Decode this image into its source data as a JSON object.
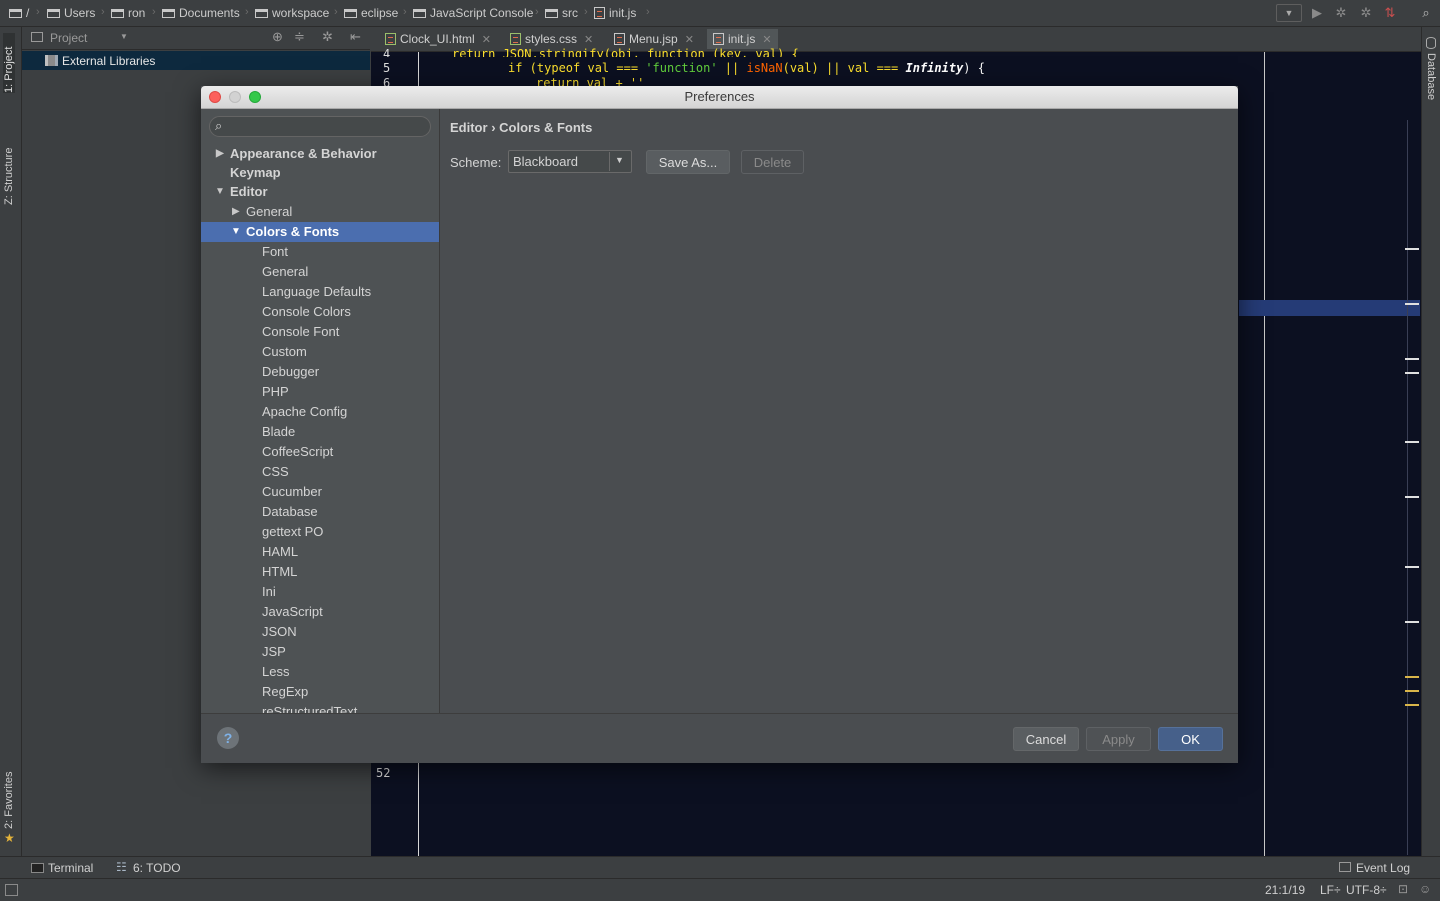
{
  "navbar": {
    "crumbs": [
      "/",
      "Users",
      "ron",
      "Documents",
      "workspace",
      "eclipse",
      "JavaScript Console",
      "src",
      "init.js"
    ]
  },
  "leftstrip": {
    "project": "1: Project",
    "structure": "Z: Structure",
    "favorites": "2: Favorites"
  },
  "project": {
    "header": "Project",
    "external_libraries": "External Libraries"
  },
  "tabs": [
    {
      "label": "Clock_UI.html"
    },
    {
      "label": "styles.css"
    },
    {
      "label": "Menu.jsp"
    },
    {
      "label": "init.js"
    }
  ],
  "editor": {
    "line_numbers": [
      "4",
      "5",
      "6",
      "52"
    ],
    "code_top": "return JSON.stringify(obj, function (key, val) {",
    "code_line5_kw": "if (typeof val",
    "code_line5_op": "===",
    "code_line5_str": "'function'",
    "code_line5_or": "||",
    "code_line5_isnan": "isNaN",
    "code_line5_val": "(val)",
    "code_line5_or2": "||",
    "code_line5_val2": "val",
    "code_line5_op2": "===",
    "code_line5_inf": "Infinity",
    "code_line5_end": ") {",
    "code_line6": "return val + ''"
  },
  "rightstrip": {
    "database": "Database"
  },
  "bottom": {
    "terminal": "Terminal",
    "todo": "6: TODO",
    "event_log": "Event Log"
  },
  "status": {
    "position": "21:1/19",
    "line_sep": "LF÷",
    "encoding": "UTF-8÷"
  },
  "dialog": {
    "title": "Preferences",
    "search_placeholder": "",
    "breadcrumb_parent": "Editor",
    "breadcrumb_sep": "›",
    "breadcrumb_current": "Colors & Fonts",
    "scheme_label": "Scheme:",
    "scheme_value": "Blackboard",
    "save_as": "Save As...",
    "delete": "Delete",
    "tree": {
      "appearance": "Appearance & Behavior",
      "keymap": "Keymap",
      "editor": "Editor",
      "general": "General",
      "colors_fonts": "Colors & Fonts",
      "children": [
        "Font",
        "General",
        "Language Defaults",
        "Console Colors",
        "Console Font",
        "Custom",
        "Debugger",
        "PHP",
        "Apache Config",
        "Blade",
        "CoffeeScript",
        "CSS",
        "Cucumber",
        "Database",
        "gettext PO",
        "HAML",
        "HTML",
        "Ini",
        "JavaScript",
        "JSON",
        "JSP",
        "Less",
        "RegExp",
        "reStructuredText"
      ]
    },
    "cancel": "Cancel",
    "apply": "Apply",
    "ok": "OK",
    "help": "?"
  }
}
